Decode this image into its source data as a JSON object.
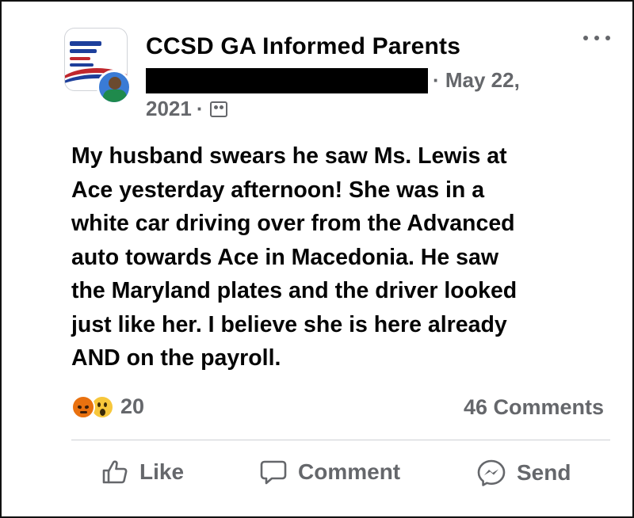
{
  "post": {
    "group_name": "CCSD GA Informed Parents",
    "date_part1": "· May 22,",
    "date_part2": "2021",
    "date_separator": "·",
    "privacy_icon": "group-privacy-icon",
    "body_lines": [
      "My husband swears he saw Ms. Lewis at",
      "Ace yesterday afternoon! She was in a",
      "white car driving over from the Advanced",
      "auto towards Ace in Macedonia. He saw",
      "the Maryland plates and the driver looked",
      "just like her. I believe she is here already",
      "AND on the payroll."
    ]
  },
  "reactions": {
    "icons": [
      "angry-reaction-icon",
      "wow-reaction-icon"
    ],
    "count": "20"
  },
  "comments": {
    "count_label": "46 Comments"
  },
  "actions": {
    "like_label": "Like",
    "comment_label": "Comment",
    "send_label": "Send"
  },
  "colors": {
    "text_primary": "#050505",
    "text_secondary": "#65676b",
    "divider": "#ced0d4",
    "angry": "#e9710f",
    "wow": "#f7c73b"
  }
}
